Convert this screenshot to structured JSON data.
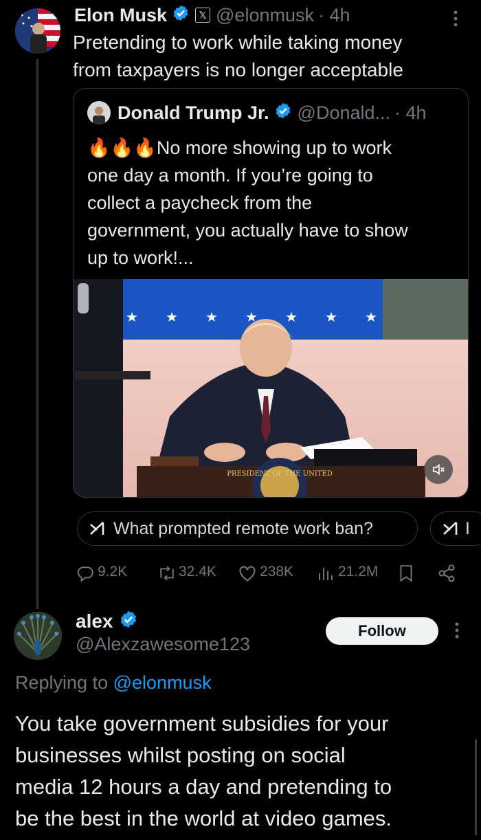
{
  "tweet": {
    "author_name": "Elon Musk",
    "badge_label": "𝕏",
    "handle": "@elonmusk",
    "time": "· 4h",
    "text_line1": "Pretending to work while taking money",
    "text_line2": "from taxpayers is no longer acceptable"
  },
  "quote": {
    "author_name": "Donald Trump Jr.",
    "handle": "@Donald...",
    "time": "· 4h",
    "emoji": "🔥🔥🔥",
    "line1": "No more showing up to work",
    "line2": "one day a month. If you’re going to",
    "line3": "collect a paycheck from the",
    "line4": "government, you actually have to show",
    "line5": "up to work!...",
    "seal_text": "PRESIDENT OF THE UNITED"
  },
  "grok": {
    "prompt": "What prompted remote work ban?",
    "prompt2": "I"
  },
  "actions": {
    "replies": "9.2K",
    "reposts": "32.4K",
    "likes": "238K",
    "views": "21.2M"
  },
  "reply": {
    "author_name": "alex",
    "handle": "@Alexzawesome123",
    "follow_label": "Follow",
    "replying_prefix": "Replying to",
    "replying_to": "@elonmusk",
    "line1": "You take government subsidies for your",
    "line2": "businesses whilst posting on social",
    "line3": "media 12 hours a day and pretending to",
    "line4": "be the best in the world at video games."
  },
  "colors": {
    "background": "#000000",
    "text": "#e7e9ea",
    "muted": "#71767b",
    "link": "#1d9bf0",
    "verified": "#1d9bf0",
    "border": "#2f3336"
  }
}
